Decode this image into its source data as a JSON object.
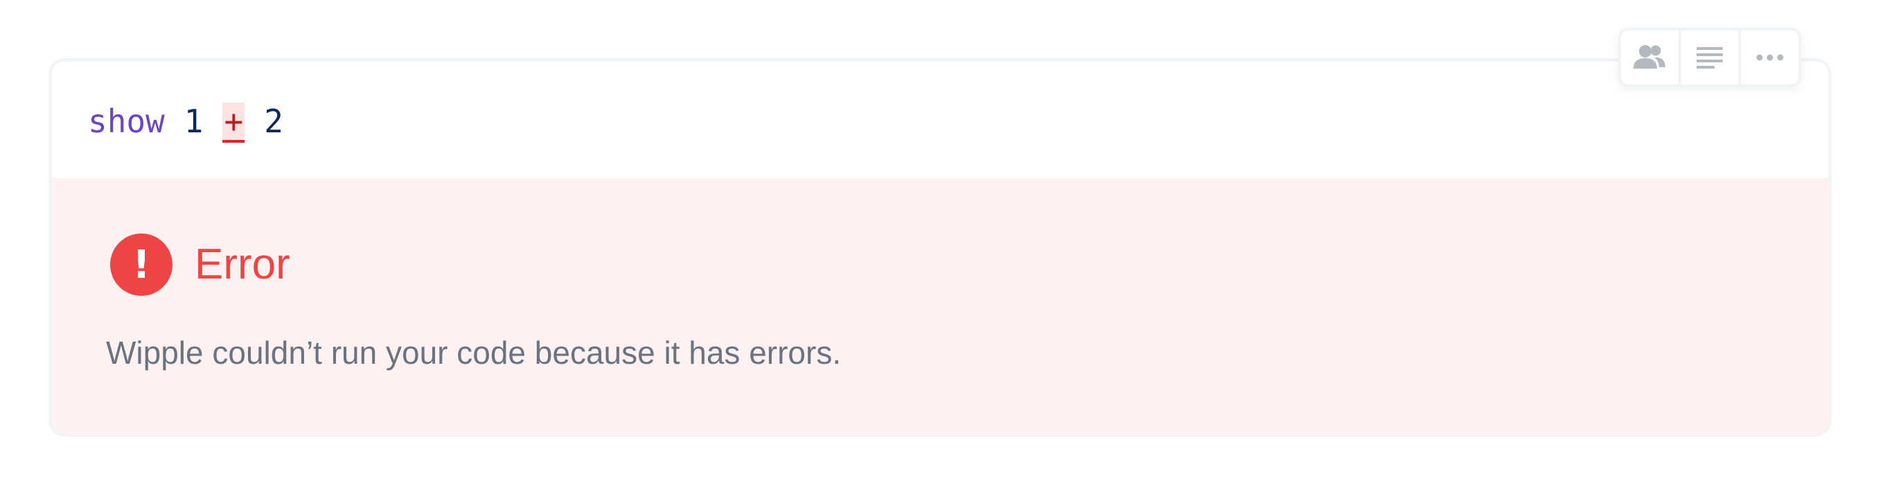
{
  "code": {
    "tokens": {
      "keyword": "show",
      "left_operand": "1",
      "operator": "+",
      "right_operand": "2"
    }
  },
  "error": {
    "title": "Error",
    "message": "Wipple couldn’t run your code because it has errors.",
    "icon": "exclamation-icon"
  },
  "toolbar": {
    "icons": [
      "users-icon",
      "text-lines-icon",
      "more-horizontal-icon"
    ]
  },
  "colors": {
    "error_red": "#ef4444",
    "error_background": "#fef1f1",
    "keyword_purple": "#6b46c1",
    "number_navy": "#0b2a5b",
    "message_gray": "#6b7280"
  }
}
